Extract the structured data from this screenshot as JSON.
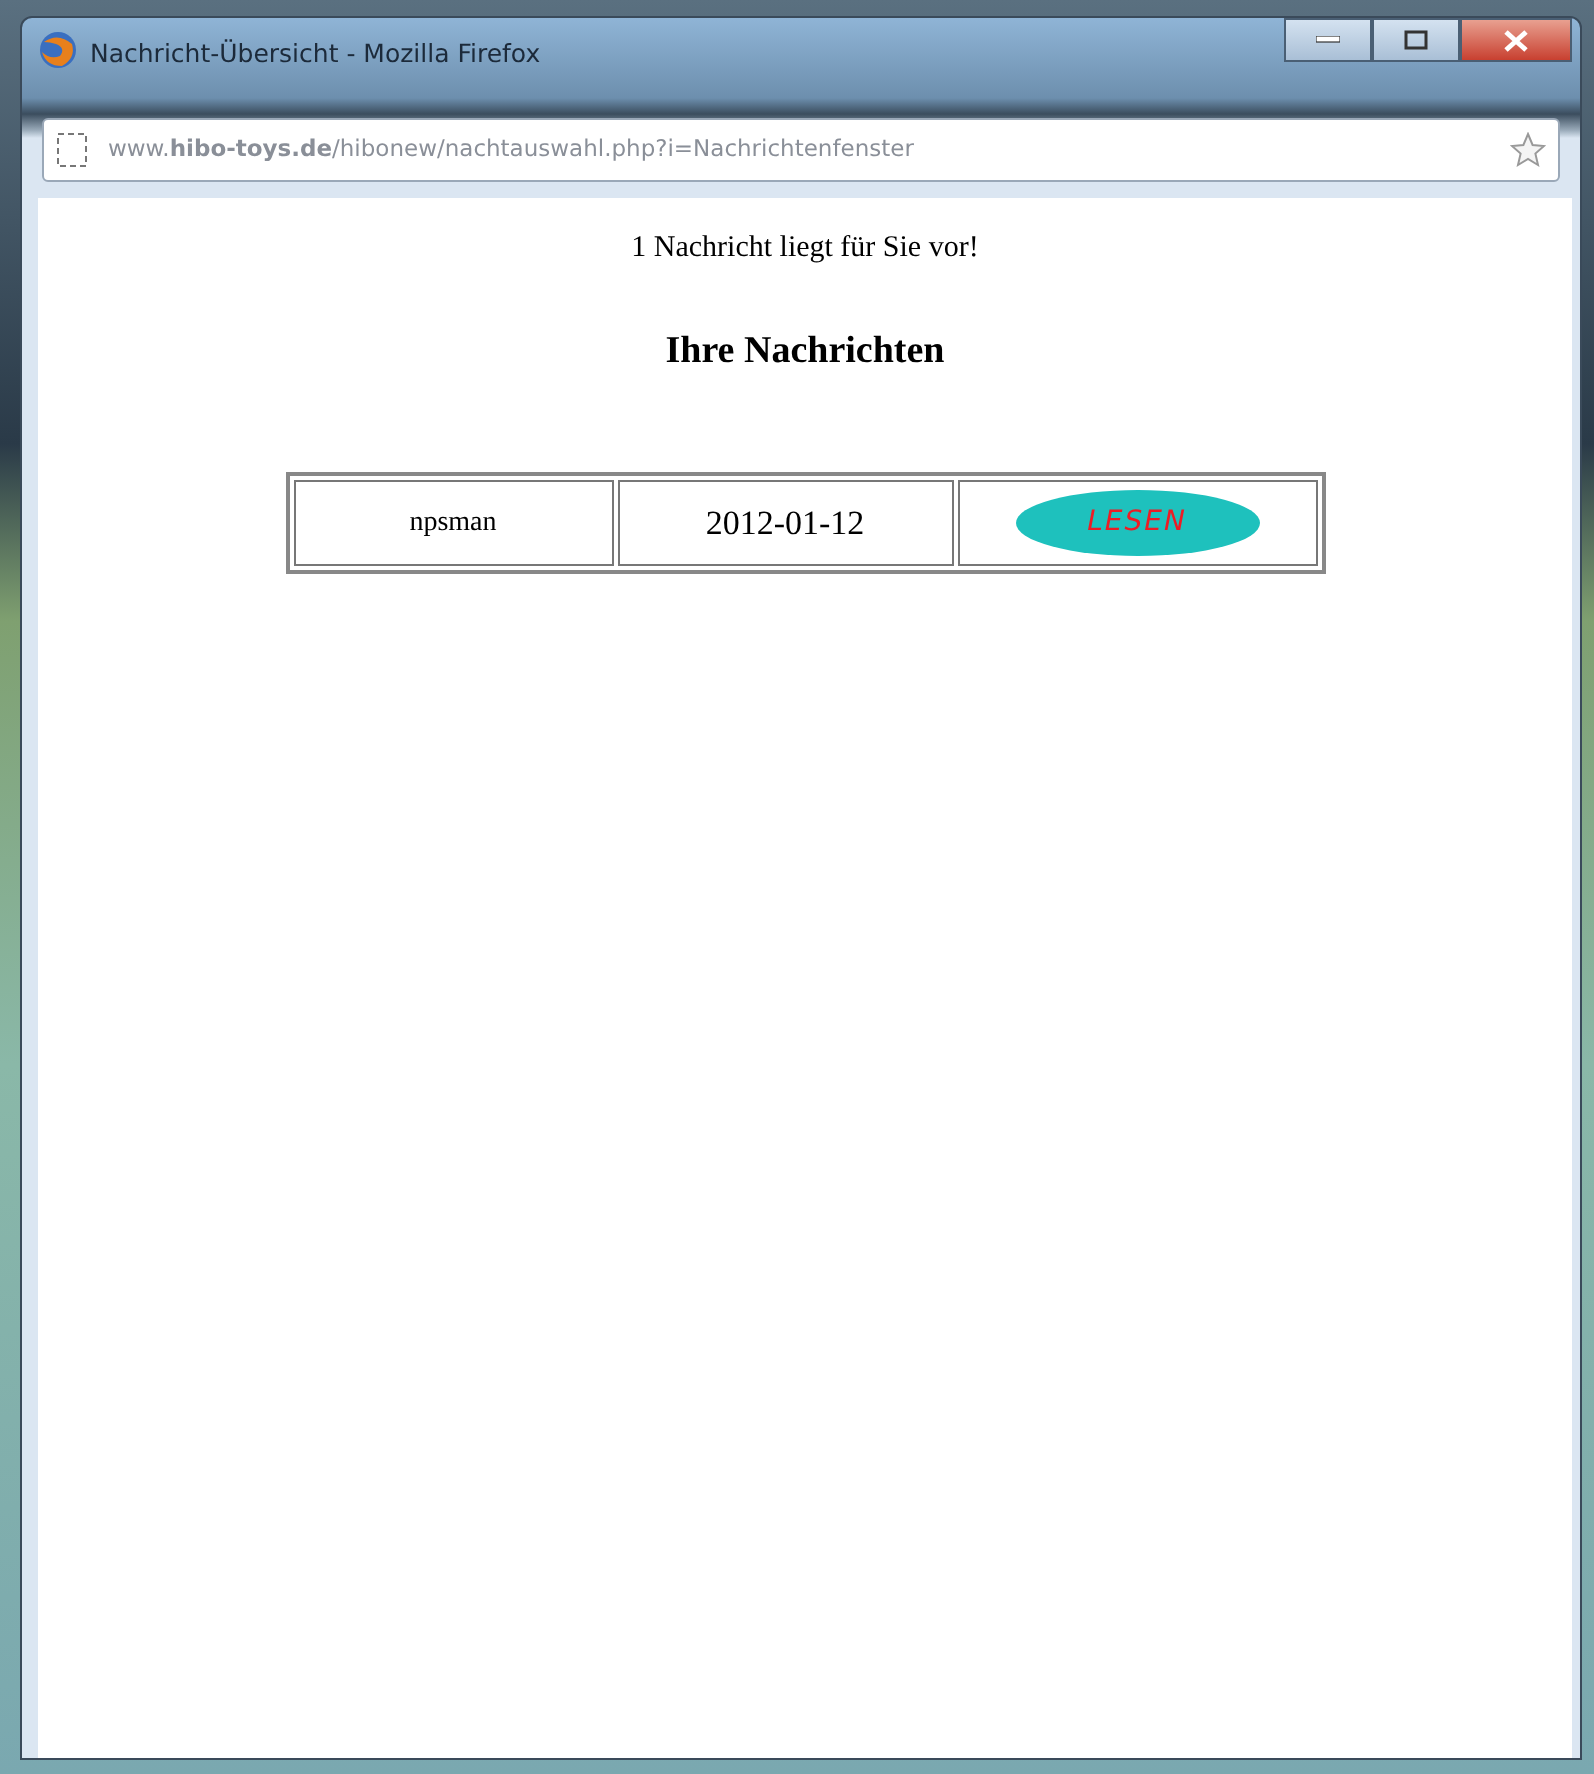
{
  "window": {
    "title": "Nachricht-Übersicht - Mozilla Firefox"
  },
  "address_bar": {
    "url": "www.**hibo-toys.de**/hibonew/nachtauswahl.php?i=Nachrichtenfenster"
  },
  "page": {
    "notice": "1 Nachricht liegt für Sie vor!",
    "heading": "Ihre Nachrichten"
  },
  "messages": [
    {
      "sender": "npsman",
      "date": "2012-01-12",
      "action": "LESEN"
    }
  ]
}
